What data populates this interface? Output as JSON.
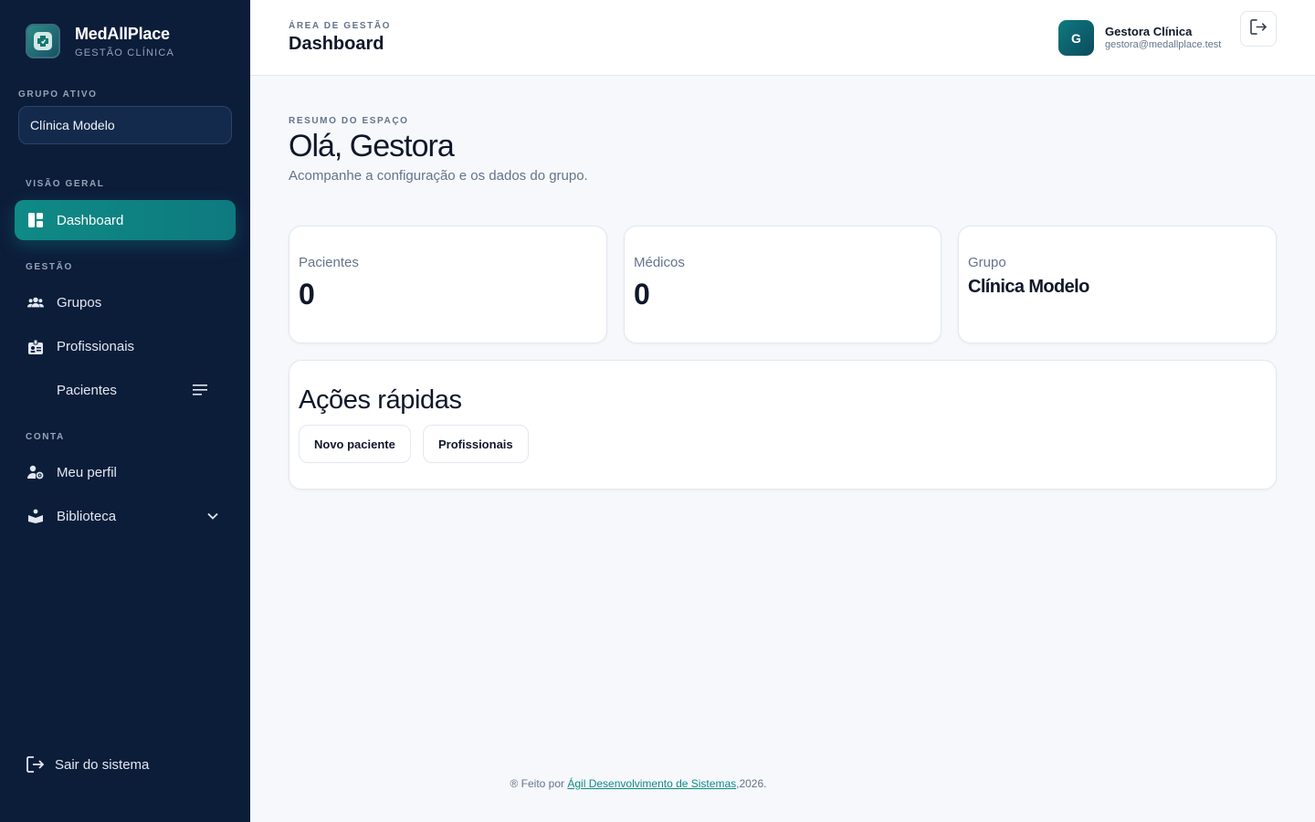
{
  "brand": {
    "name": "MedAllPlace",
    "subtitle": "GESTÃO CLÍNICA",
    "logo_icon": "medical-cross-icon"
  },
  "sidebar": {
    "group_label": "GRUPO ATIVO",
    "group_value": "Clínica Modelo",
    "sections": {
      "overview": "VISÃO GERAL",
      "management": "GESTÃO",
      "account": "CONTA"
    },
    "items": [
      {
        "label": "Dashboard",
        "icon": "dashboard-icon",
        "active": true
      },
      {
        "label": "Grupos",
        "icon": "groups-icon"
      },
      {
        "label": "Profissionais",
        "icon": "badge-icon"
      },
      {
        "label": "Pacientes",
        "icon": "menu-lines-icon"
      },
      {
        "label": "Meu perfil",
        "icon": "user-settings-icon"
      },
      {
        "label": "Biblioteca",
        "icon": "book-icon",
        "expandable": true
      }
    ],
    "logout_label": "Sair do sistema"
  },
  "header": {
    "kicker": "ÁREA DE GESTÃO",
    "title": "Dashboard",
    "user_initial": "G",
    "user_name": "Gestora Clínica",
    "user_email": "gestora@medallplace.test"
  },
  "main": {
    "kicker": "RESUMO DO ESPAÇO",
    "title": "Olá, Gestora",
    "subtitle": "Acompanhe a configuração e os dados do grupo.",
    "stats": [
      {
        "label": "Pacientes",
        "value": "0"
      },
      {
        "label": "Médicos",
        "value": "0"
      },
      {
        "label": "Grupo",
        "value": "Clínica Modelo"
      }
    ],
    "quick_actions": {
      "title": "Ações rápidas",
      "buttons": [
        "Novo paciente",
        "Profissionais"
      ]
    }
  },
  "footer": {
    "prefix": "® Feito por ",
    "link": "Ágil Desenvolvimento de Sistemas",
    "suffix": ",2026."
  },
  "colors": {
    "sidebar_bg": "#0c1d3a",
    "accent": "#0f8a86",
    "page_bg": "#f6f8fb"
  }
}
